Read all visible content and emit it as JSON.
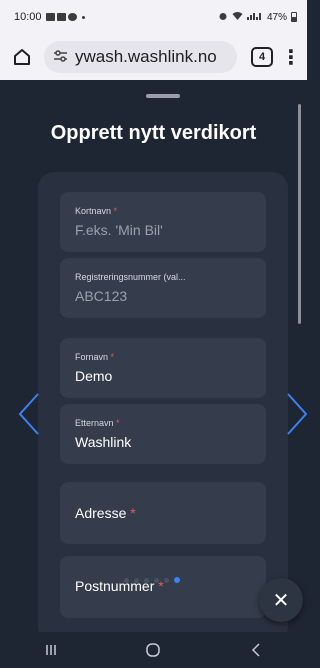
{
  "status": {
    "time": "10:00",
    "battery": "47%"
  },
  "browser": {
    "url": "ywash.washlink.no",
    "tab_count": "4",
    "menu": "⋮"
  },
  "sheet": {
    "title": "Opprett nytt verdikort"
  },
  "form": {
    "card_name": {
      "label": "Kortnavn",
      "required_mark": "*",
      "placeholder": "F.eks. 'Min Bil'"
    },
    "reg_number": {
      "label": "Registreringsnummer (val...",
      "placeholder": "ABC123"
    },
    "first_name": {
      "label": "Fornavn",
      "required_mark": "*",
      "value": "Demo"
    },
    "last_name": {
      "label": "Etternavn",
      "required_mark": "*",
      "value": "Washlink"
    },
    "address": {
      "label": "Adresse",
      "required_mark": "*"
    },
    "postal_code": {
      "label": "Postnummer",
      "required_mark": "*"
    }
  },
  "close_button": {
    "symbol": "✕"
  },
  "pagination": {
    "total": 6,
    "active_index": 5
  },
  "colors": {
    "accent": "#3b82f6",
    "required": "#e85a5a",
    "background": "#1e2533",
    "card": "#29303f",
    "field": "#353d4d"
  },
  "icons": [
    "home-icon",
    "site-settings-icon",
    "tab-switcher-icon",
    "more-menu-icon",
    "chevron-left-icon",
    "chevron-right-icon",
    "close-icon",
    "recent-apps-icon",
    "home-circle-icon",
    "back-icon"
  ]
}
